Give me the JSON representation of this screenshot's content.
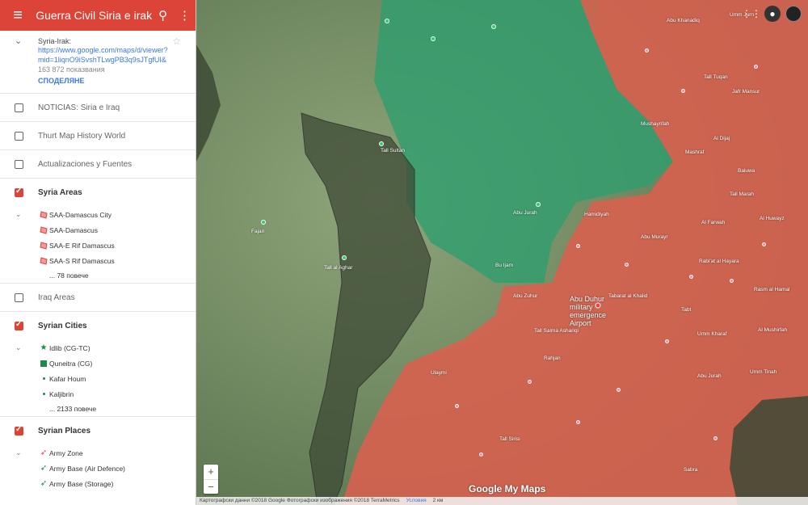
{
  "topbar": {
    "title": "Guerra Civil Siria e irak",
    "menu_icon": "≡",
    "search_icon": "⚲",
    "more_icon": "⋮"
  },
  "mapinfo": {
    "name": "Syria-Irak:",
    "link": "https://www.google.com/maps/d/viewer?mid=1liqnO9iSvshTLwgPB3q9sJTgfUI&",
    "views": "163 872 показвания",
    "share": "СПОДЕЛЯНЕ"
  },
  "layers": {
    "noticias": "NOTICIAS: Siria e Iraq",
    "thurt": "Thurt Map History World",
    "actualizaciones": "Actualizaciones y Fuentes",
    "syria_areas": {
      "label": "Syria Areas",
      "items": [
        "SAA-Damascus City",
        "SAA-Damascus",
        "SAA-E Rif Damascus",
        "SAA-S Rif Damascus"
      ],
      "more": "... 78 повече"
    },
    "iraq_areas": "Iraq Areas",
    "syrian_cities": {
      "label": "Syrian Cities",
      "items": [
        "Idlib (CG-TC)",
        "Quneitra (CG)",
        "Kafar Houm",
        "Kaljibrin"
      ],
      "more": "... 2133 повече"
    },
    "syrian_places": {
      "label": "Syrian Places",
      "items": [
        "Army Zone",
        "Army Base (Air Defence)",
        "Army Base (Storage)"
      ]
    }
  },
  "colors": {
    "accent": "#db4437",
    "red_zone": "#d9604e",
    "green_zone": "#2e9e6e",
    "dark_zone": "#3d4a35"
  },
  "map": {
    "labels": {
      "abu_duhur": "Abu Duhur military emergence Airport",
      "talltin": "Tall Sultan",
      "abu_jurah": "Abu Jurah",
      "tall_khalwa": "Tall Khalwa",
      "bu_ijam": "Bu Ijam",
      "tall_al_aghar": "Tall al Aghar",
      "abu_zuhur": "Abu Zuhur",
      "tabarat_al_khalid": "Tabarat al Khalid",
      "hamidi": "Hamidiyah",
      "tall_salma": "Tall Salma Ashariqi",
      "rahjan": "Rahjan",
      "fajan": "Fajan",
      "ulaymi": "Ulaymi",
      "tell_zahab": "Tall Sirisi",
      "rasm_al_hamal": "Rasm al Hamal",
      "um_tinah": "Umm Tinah",
      "abu_jurah2": "Abu Jurah",
      "baluwa": "Baluwa",
      "abu_mujayr": "Abu Murayr",
      "rabi_at": "Rabi'at al Hayara",
      "mushayrifah": "Mushayrifah",
      "al_huwayz": "Al Huwayz",
      "al_dijaj": "Al Dijaj",
      "tall_tuqan": "Tall Tuqan",
      "tall_marah": "Tall Marah",
      "al_farwah": "Al Farwah",
      "umm_khalif": "Umm Kharaf",
      "al_mushirfah": "Al Mushirfah",
      "jafr_mansur": "Jafr Mansur",
      "um_jurn": "Umm Jurn",
      "abu_khanadiq": "Abu Khanadiq",
      "mashraf": "Mashraf",
      "tabt": "Tabt",
      "sabra": "Sabra"
    }
  },
  "footer": {
    "data": "Картографски данни ©2018 Google Фотографски изображения ©2018 TerraMetrics",
    "terms": "Условия",
    "scale": "2 км"
  },
  "logo": "Google My Maps",
  "zoom": {
    "plus": "+",
    "minus": "−"
  }
}
